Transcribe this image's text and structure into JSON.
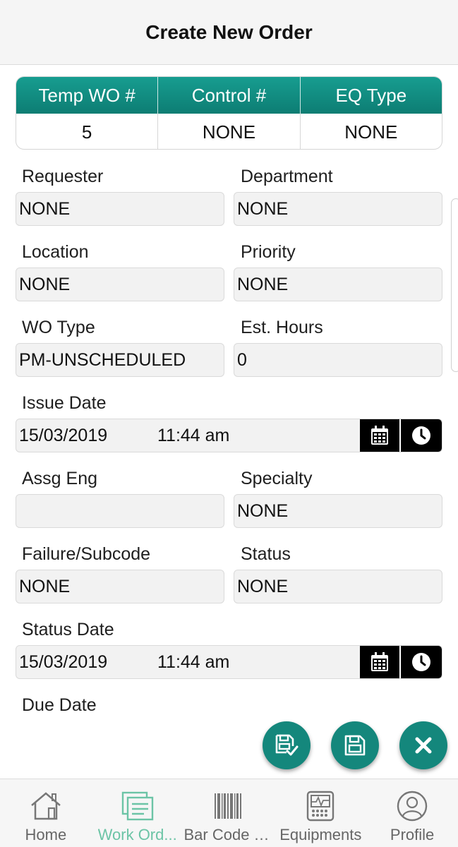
{
  "header": {
    "title": "Create New Order"
  },
  "summary": {
    "headers": [
      "Temp WO #",
      "Control #",
      "EQ Type"
    ],
    "values": [
      "5",
      "NONE",
      "NONE"
    ]
  },
  "form": {
    "requester": {
      "label": "Requester",
      "value": "NONE"
    },
    "department": {
      "label": "Department",
      "value": "NONE"
    },
    "location": {
      "label": "Location",
      "value": "NONE"
    },
    "priority": {
      "label": "Priority",
      "value": "NONE"
    },
    "wo_type": {
      "label": "WO Type",
      "value": "PM-UNSCHEDULED"
    },
    "est_hours": {
      "label": "Est. Hours",
      "value": "0"
    },
    "issue_date": {
      "label": "Issue Date",
      "date": "15/03/2019",
      "time": "11:44 am"
    },
    "assg_eng": {
      "label": "Assg Eng",
      "value": ""
    },
    "specialty": {
      "label": "Specialty",
      "value": "NONE"
    },
    "failure": {
      "label": "Failure/Subcode",
      "value": "NONE"
    },
    "status": {
      "label": "Status",
      "value": "NONE"
    },
    "status_date": {
      "label": "Status Date",
      "date": "15/03/2019",
      "time": "11:44 am"
    },
    "due_date": {
      "label": "Due Date"
    }
  },
  "nav": {
    "items": [
      {
        "label": "Home",
        "icon": "home-icon"
      },
      {
        "label": "Work Ord...",
        "icon": "work-orders-icon"
      },
      {
        "label": "Bar Code S...",
        "icon": "barcode-icon"
      },
      {
        "label": "Equipments",
        "icon": "equipment-monitor-icon"
      },
      {
        "label": "Profile",
        "icon": "profile-icon"
      }
    ]
  },
  "colors": {
    "accent": "#14877c",
    "header_gradient_top": "#179d90",
    "nav_active": "#6cc4a6"
  }
}
